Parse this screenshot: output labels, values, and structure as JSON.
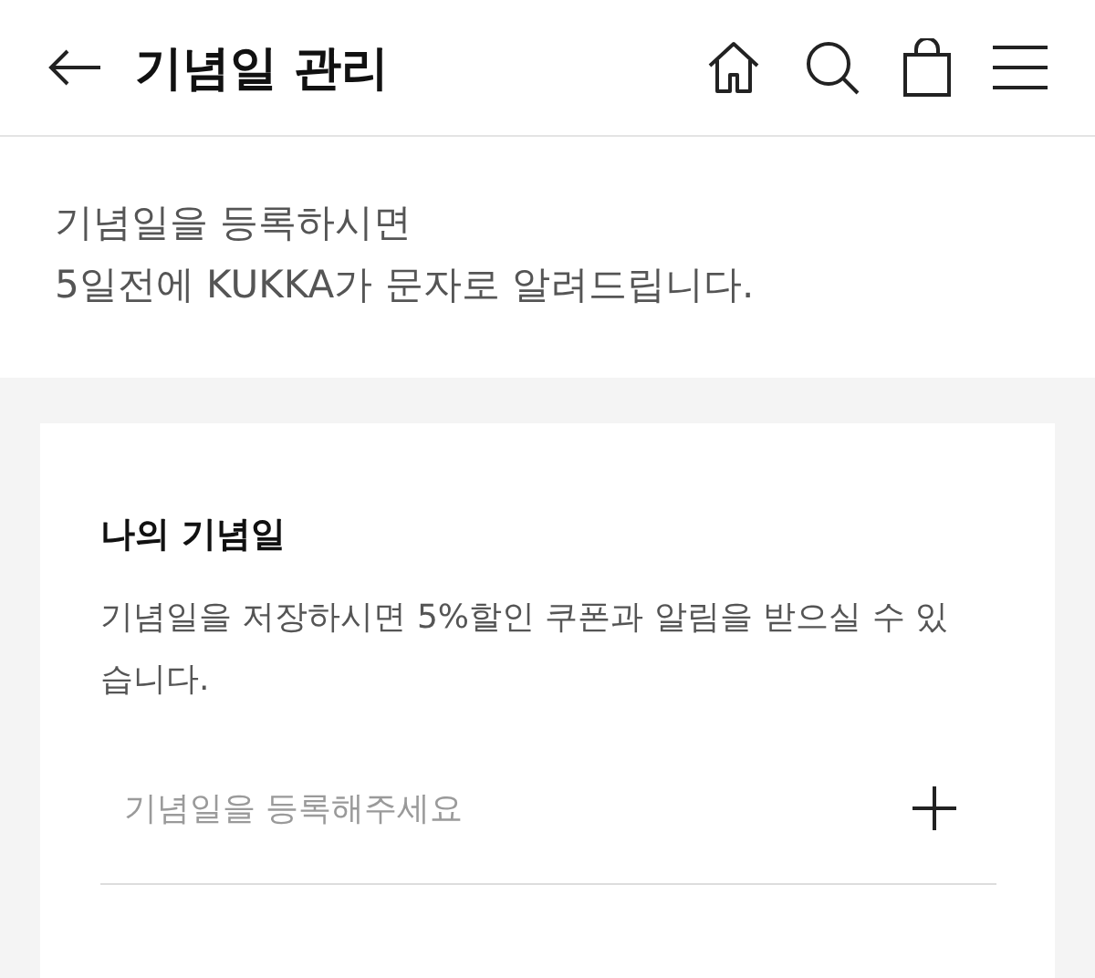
{
  "header": {
    "title": "기념일 관리"
  },
  "notice": {
    "lines": [
      "기념일을 등록하시면",
      "5일전에 KUKKA가 문자로 알려드립니다."
    ]
  },
  "card": {
    "title": "나의 기념일",
    "description": "기념일을 저장하시면 5%할인 쿠폰과 알림을 받으실 수 있습니다.",
    "field": {
      "placeholder": "기념일을 등록해주세요"
    }
  }
}
